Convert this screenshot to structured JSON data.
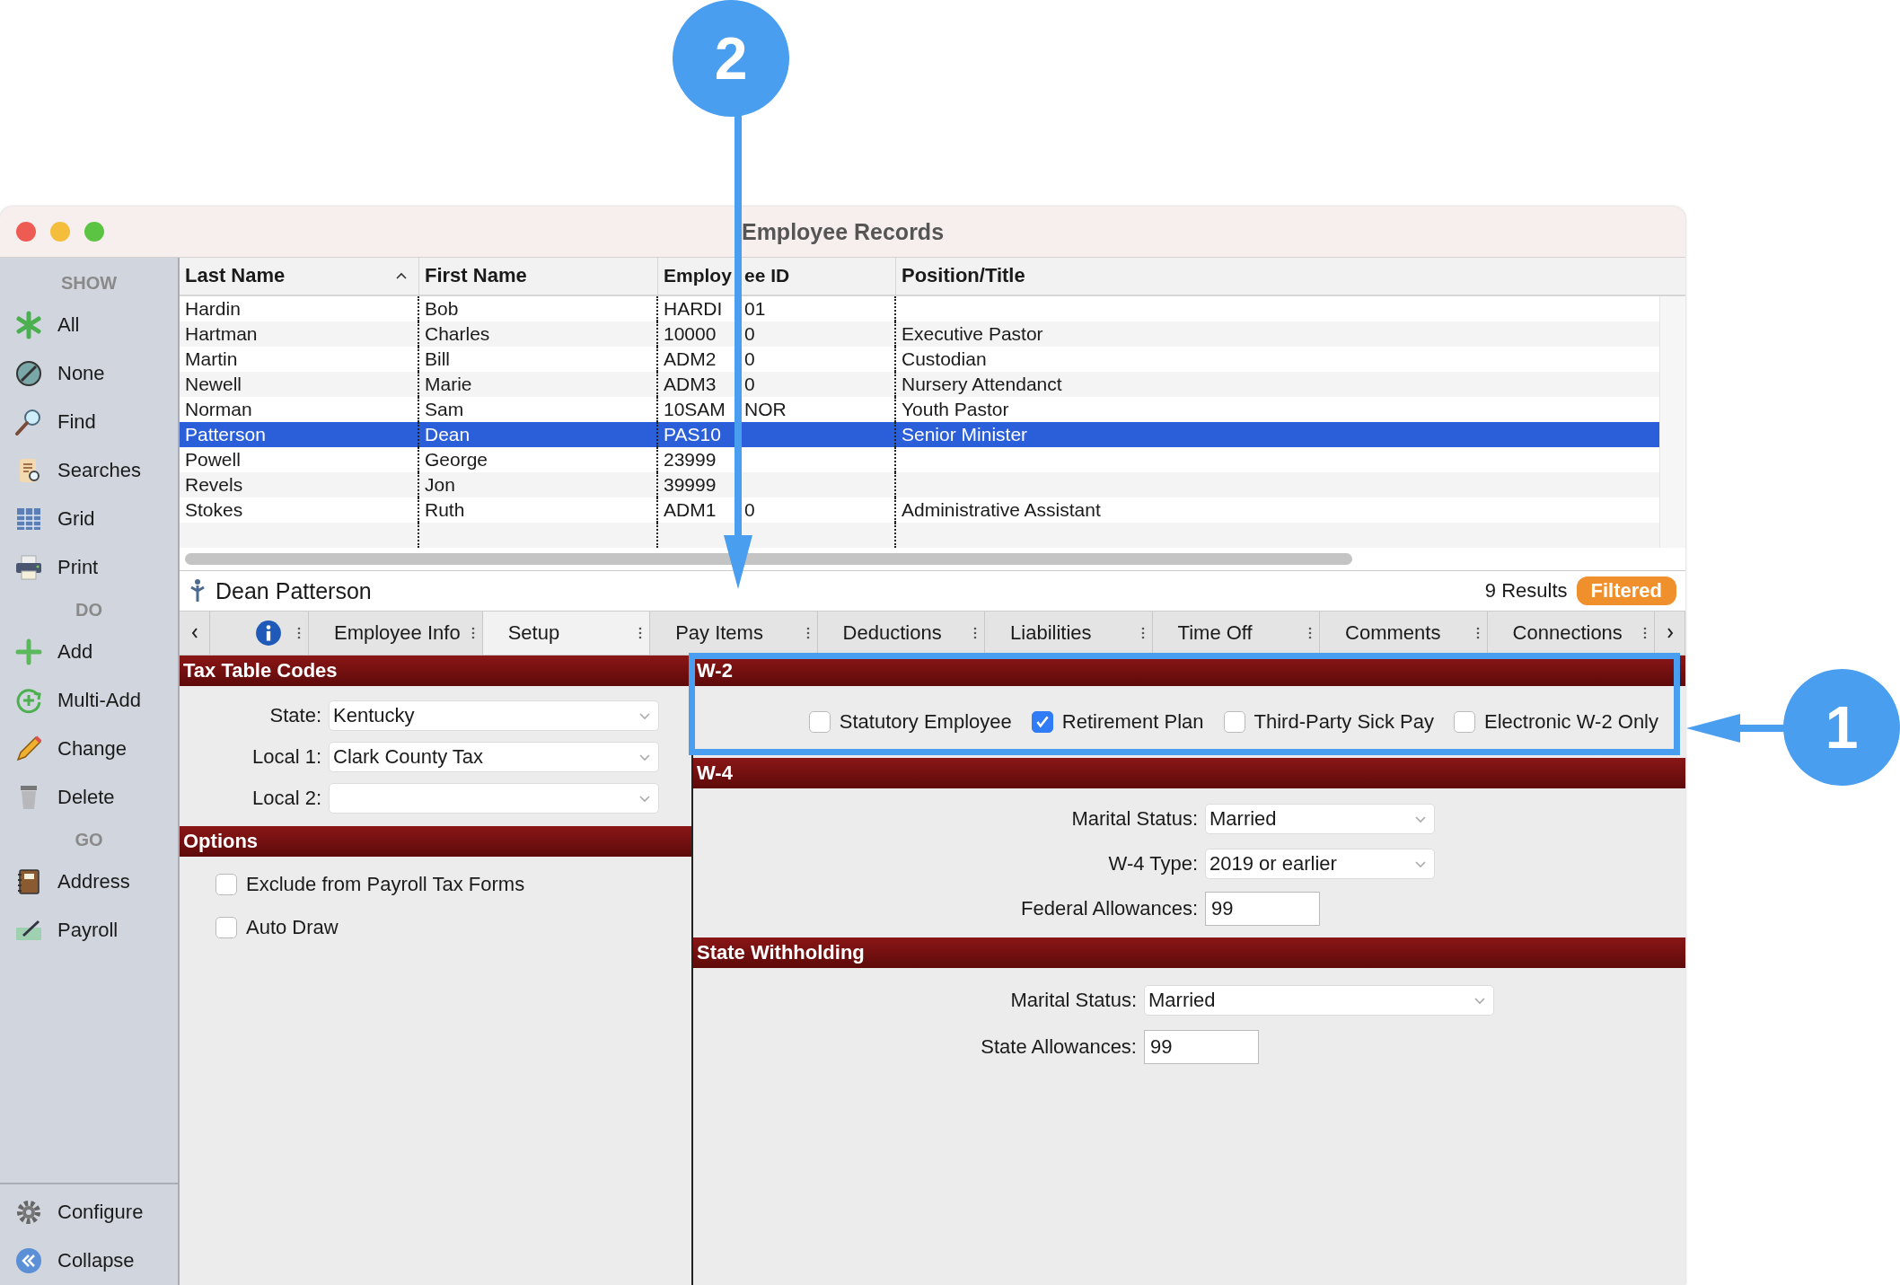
{
  "window": {
    "title": "Employee Records"
  },
  "sidebar": {
    "sections": [
      {
        "heading": "SHOW",
        "items": [
          {
            "label": "All"
          },
          {
            "label": "None"
          },
          {
            "label": "Find"
          },
          {
            "label": "Searches"
          },
          {
            "label": "Grid"
          },
          {
            "label": "Print"
          }
        ]
      },
      {
        "heading": "DO",
        "items": [
          {
            "label": "Add"
          },
          {
            "label": "Multi-Add"
          },
          {
            "label": "Change"
          },
          {
            "label": "Delete"
          }
        ]
      },
      {
        "heading": "GO",
        "items": [
          {
            "label": "Address"
          },
          {
            "label": "Payroll"
          }
        ]
      }
    ],
    "footer": [
      {
        "label": "Configure"
      },
      {
        "label": "Collapse"
      }
    ]
  },
  "table": {
    "columns": [
      {
        "label": "Last Name",
        "sorted": true
      },
      {
        "label": "First Name",
        "sorted": false
      },
      {
        "label": [
          "Employ",
          "ee ID"
        ],
        "sorted": false
      },
      {
        "label": "Position/Title",
        "sorted": false
      }
    ],
    "rows": [
      {
        "cells": [
          "Hardin",
          "Bob",
          [
            "HARDI",
            "01"
          ]
        ],
        "selected": false
      },
      {
        "cells": [
          "Hartman",
          "Charles",
          [
            "10000",
            "0"
          ],
          "Executive Pastor"
        ],
        "selected": false
      },
      {
        "cells": [
          "Martin",
          "Bill",
          [
            "ADM2",
            "0"
          ],
          "Custodian"
        ],
        "selected": false
      },
      {
        "cells": [
          "Newell",
          "Marie",
          [
            "ADM3",
            "0"
          ],
          "Nursery Attendanct"
        ],
        "selected": false
      },
      {
        "cells": [
          "Norman",
          "Sam",
          [
            "10SAM",
            "NOR"
          ],
          "Youth Pastor"
        ],
        "selected": false
      },
      {
        "cells": [
          "Patterson",
          "Dean",
          "PAS10",
          "Senior Minister"
        ],
        "selected": true
      },
      {
        "cells": [
          "Powell",
          "George",
          "23999"
        ],
        "selected": false
      },
      {
        "cells": [
          "Revels",
          "Jon",
          "39999"
        ],
        "selected": false
      },
      {
        "cells": [
          "Stokes",
          "Ruth",
          [
            "ADM1",
            "0"
          ],
          "Administrative Assistant"
        ],
        "selected": false
      }
    ]
  },
  "record": {
    "name": "Dean Patterson",
    "results": "9 Results",
    "badge": "Filtered"
  },
  "tabs": [
    {
      "label": "Employee Info",
      "selected": false
    },
    {
      "label": "Setup",
      "selected": true
    },
    {
      "label": "Pay Items",
      "selected": false
    },
    {
      "label": "Deductions",
      "selected": false
    },
    {
      "label": "Liabilities",
      "selected": false
    },
    {
      "label": "Time Off",
      "selected": false
    },
    {
      "label": "Comments",
      "selected": false
    },
    {
      "label": "Connections",
      "selected": false
    }
  ],
  "tax_table_codes": {
    "title": "Tax Table Codes",
    "fields": [
      {
        "label": "State:",
        "value": "Kentucky"
      },
      {
        "label": "Local 1:",
        "value": "Clark County Tax"
      },
      {
        "label": "Local 2:"
      }
    ]
  },
  "options": {
    "title": "Options",
    "checkboxes": [
      {
        "label": "Exclude from Payroll Tax Forms",
        "checked": false
      },
      {
        "label": "Auto Draw",
        "checked": false
      }
    ]
  },
  "w2": {
    "title": "W-2",
    "checkboxes": [
      {
        "label": "Statutory Employee",
        "checked": false
      },
      {
        "label": "Retirement Plan",
        "checked": true
      },
      {
        "label": "Third-Party Sick Pay",
        "checked": false
      },
      {
        "label": "Electronic W-2 Only",
        "checked": false
      }
    ]
  },
  "w4": {
    "title": "W-4",
    "fields": [
      {
        "kind": "select",
        "label": "Marital Status:",
        "value": "Married"
      },
      {
        "kind": "select",
        "label": "W-4 Type:",
        "value": "2019 or earlier"
      },
      {
        "kind": "text",
        "label": "Federal Allowances:",
        "value": "99"
      }
    ]
  },
  "state_withholding": {
    "title": "State Withholding",
    "fields": [
      {
        "kind": "select",
        "label": "Marital Status:",
        "value": "Married"
      },
      {
        "kind": "text",
        "label": "State Allowances:",
        "value": "99"
      }
    ]
  },
  "annotations": [
    {
      "label": "1"
    },
    {
      "label": "2"
    }
  ]
}
